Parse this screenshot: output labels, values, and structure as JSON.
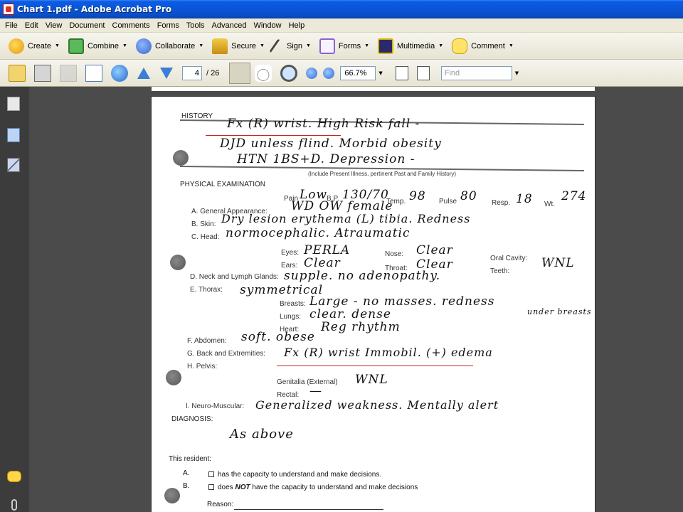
{
  "window": {
    "title": "Chart 1.pdf - Adobe Acrobat Pro"
  },
  "menu": [
    "File",
    "Edit",
    "View",
    "Document",
    "Comments",
    "Forms",
    "Tools",
    "Advanced",
    "Window",
    "Help"
  ],
  "toolbar": {
    "create": "Create",
    "combine": "Combine",
    "collaborate": "Collaborate",
    "secure": "Secure",
    "sign": "Sign",
    "forms": "Forms",
    "multimedia": "Multimedia",
    "comment": "Comment"
  },
  "nav": {
    "current_page": "4",
    "total_pages": "/ 26",
    "zoom": "66.7%",
    "find_placeholder": "Find"
  },
  "document": {
    "history_label": "HISTORY",
    "history_text": [
      "Fx (R) wrist. High Risk fall -",
      "DJD unless flind. Morbid obesity",
      "HTN 1BS+D. Depression -"
    ],
    "history_note": "(Include Present Illness, pertinent Past and Family History)",
    "physical_label": "PHYSICAL EXAMINATION",
    "pain_label": "Pain",
    "pain_value": "Low",
    "bp_label": "B.P.",
    "bp_value": "130/70",
    "temp_label": "Temp.",
    "temp_value": "98",
    "pulse_label": "Pulse",
    "pulse_value": "80",
    "resp_label": "Resp.",
    "resp_value": "18",
    "wt_label": "Wt.",
    "wt_value": "274",
    "items": {
      "general_label": "A. General Appearance:",
      "general_value": "WD OW female",
      "skin_label": "B. Skin:",
      "skin_value": "Dry lesion erythema (L) tibia. Redness",
      "head_label": "C. Head:",
      "head_value": "normocephalic. Atraumatic",
      "eyes_label": "Eyes:",
      "eyes_value": "PERLA",
      "ears_label": "Ears:",
      "ears_value": "Clear",
      "nose_label": "Nose:",
      "nose_value": "Clear",
      "throat_label": "Throat:",
      "throat_value": "Clear",
      "oral_label": "Oral Cavity:",
      "teeth_label": "Teeth:",
      "oral_value": "WNL",
      "neck_label": "D. Neck and Lymph Glands:",
      "neck_value": "supple. no adenopathy.",
      "thorax_label": "E. Thorax:",
      "thorax_value": "symmetrical",
      "breasts_label": "Breasts:",
      "breasts_value": "Large - no masses. redness",
      "breasts_value2": "under breasts",
      "lungs_label": "Lungs:",
      "lungs_value": "clear. dense",
      "heart_label": "Heart:",
      "heart_value": "Reg rhythm",
      "abdomen_label": "F. Abdomen:",
      "abdomen_value": "soft. obese",
      "back_label": "G. Back and Extremities:",
      "back_value": "Fx (R) wrist Immobil. (+) edema",
      "pelvis_label": "H. Pelvis:",
      "genitalia_label": "Genitalia (External)",
      "genitalia_value": "WNL",
      "rectal_label": "Rectal:",
      "rectal_value": "—",
      "neuro_label": "I. Neuro-Muscular:",
      "neuro_value": "Generalized weakness. Mentally alert"
    },
    "diagnosis_label": "DIAGNOSIS:",
    "diagnosis_value": "As above",
    "resident_label": "This resident:",
    "option_a_letter": "A.",
    "option_a_text": "has the capacity to understand and make decisions.",
    "option_b_letter": "B.",
    "option_b_pre": "does ",
    "option_b_not": "NOT",
    "option_b_post": " have the capacity to understand and make decisions",
    "reason_label": "Reason:"
  }
}
